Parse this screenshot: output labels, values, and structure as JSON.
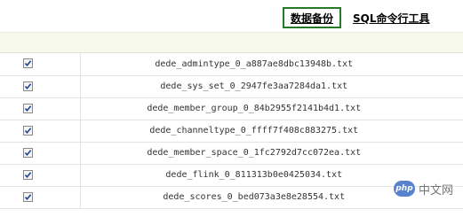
{
  "toolbar": {
    "backup_tab": "数据备份",
    "sql_tab": "SQL命令行工具"
  },
  "files": [
    {
      "checked": true,
      "name": "dede_admintype_0_a887ae8dbc13948b.txt"
    },
    {
      "checked": true,
      "name": "dede_sys_set_0_2947fe3aa7284da1.txt"
    },
    {
      "checked": true,
      "name": "dede_member_group_0_84b2955f2141b4d1.txt"
    },
    {
      "checked": true,
      "name": "dede_channeltype_0_ffff7f408c883275.txt"
    },
    {
      "checked": true,
      "name": "dede_member_space_0_1fc2792d7cc072ea.txt"
    },
    {
      "checked": true,
      "name": "dede_flink_0_811313b0e0425034.txt"
    },
    {
      "checked": true,
      "name": "dede_scores_0_bed073a3e8e28554.txt"
    }
  ],
  "watermark": {
    "logo": "php",
    "text": "中文网"
  },
  "colors": {
    "active_tab_border": "#257a27",
    "header_bar": "#f7f8ec"
  }
}
